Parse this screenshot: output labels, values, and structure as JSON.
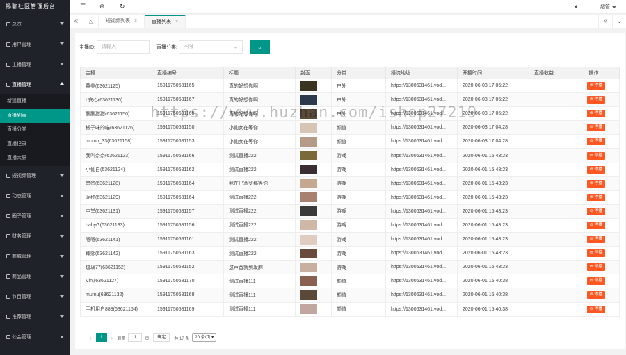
{
  "app": {
    "title": "畅聊社区管理后台"
  },
  "sidebar": {
    "items": [
      {
        "label": "总览"
      },
      {
        "label": "用户管理"
      },
      {
        "label": "主播管理"
      },
      {
        "label": "直播管理"
      },
      {
        "label": "短视频管理"
      },
      {
        "label": "动态管理"
      },
      {
        "label": "圈子管理"
      },
      {
        "label": "财务管理"
      },
      {
        "label": "商城管理"
      },
      {
        "label": "商品管理"
      },
      {
        "label": "节目管理"
      },
      {
        "label": "推荐管理"
      },
      {
        "label": "公会管理"
      }
    ],
    "sub_items": [
      {
        "label": "新建直播"
      },
      {
        "label": "直播列表"
      },
      {
        "label": "直播分类"
      },
      {
        "label": "直播记录"
      },
      {
        "label": "直播大屏"
      }
    ]
  },
  "header": {
    "user": "超管"
  },
  "tabs": [
    {
      "label": "短视频列表",
      "close": "×"
    },
    {
      "label": "直播列表",
      "close": "×"
    }
  ],
  "search": {
    "anchor_label": "主播ID:",
    "anchor_placeholder": "请输入",
    "category_label": "直播分类:",
    "category_value": "不限"
  },
  "table": {
    "columns": [
      "主播",
      "直播编号",
      "标题",
      "封面",
      "分类",
      "播流地址",
      "开播时间",
      "直播收益",
      "操作"
    ],
    "delete_label": "⊘ 停播",
    "rows": [
      {
        "anchor": "董美(63621125)",
        "no": "15911750681165",
        "title": "真的好想你啊",
        "category": "户外",
        "url": "https://1300631461.vod...",
        "time": "2020-06-03 17:06:22",
        "color": "#3a3420"
      },
      {
        "anchor": "L安心(63621130)",
        "no": "15911750681167",
        "title": "真的好想你啊",
        "category": "户外",
        "url": "https://1300631461.vod...",
        "time": "2020-06-03 17:06:22",
        "color": "#2d3a4a"
      },
      {
        "anchor": "酸酸甜甜(63621150)",
        "no": "15911750681168",
        "title": "真的好想你啊",
        "category": "户外",
        "url": "https://1300631461.vod...",
        "time": "2020-06-03 17:06:22",
        "color": "#5a4a3a"
      },
      {
        "anchor": "橘子味的喵(63621126)",
        "no": "15911750681150",
        "title": "小仙女在等你",
        "category": "颜值",
        "url": "https://1300631461.vod...",
        "time": "2020-06-03 17:04:28",
        "color": "#d8c4b4"
      },
      {
        "anchor": "momo_33(63621158)",
        "no": "15911750681153",
        "title": "小仙女在等你",
        "category": "颜值",
        "url": "https://1300631461.vod...",
        "time": "2020-06-03 17:04:28",
        "color": "#b59a88"
      },
      {
        "anchor": "我叫奈奈(63621123)",
        "no": "15911750681166",
        "title": "测试直播222",
        "category": "游戏",
        "url": "https://1300631461.vod...",
        "time": "2020-06-01 15:43:23",
        "color": "#7a6a3a"
      },
      {
        "anchor": "小仙白(63621124)",
        "no": "15911750681162",
        "title": "测试直播222",
        "category": "游戏",
        "url": "https://1300631461.vod...",
        "time": "2020-06-01 15:43:23",
        "color": "#3a2e34"
      },
      {
        "anchor": "悠然(63621128)",
        "no": "15911750681164",
        "title": "我在巴塞罗那等你",
        "category": "游戏",
        "url": "https://1300631461.vod...",
        "time": "2020-06-01 15:43:23",
        "color": "#c4a890"
      },
      {
        "anchor": "昵称(63621129)",
        "no": "15911750681164",
        "title": "测试直播222",
        "category": "游戏",
        "url": "https://1300631461.vod...",
        "time": "2020-06-01 15:43:23",
        "color": "#a88070"
      },
      {
        "anchor": "中堂(63621131)",
        "no": "15911750681157",
        "title": "测试直播222",
        "category": "游戏",
        "url": "https://1300631461.vod...",
        "time": "2020-06-01 15:43:23",
        "color": "#3a3a3a"
      },
      {
        "anchor": "babyG(63621133)",
        "no": "15911750681156",
        "title": "测试直播222",
        "category": "游戏",
        "url": "https://1300631461.vod...",
        "time": "2020-06-01 15:43:23",
        "color": "#d0b8a8"
      },
      {
        "anchor": "嗯嗯(63621141)",
        "no": "15911750681161",
        "title": "测试直播222",
        "category": "游戏",
        "url": "https://1300631461.vod...",
        "time": "2020-06-01 15:43:23",
        "color": "#e0ccc0"
      },
      {
        "anchor": "臻熙(63621142)",
        "no": "15911750681163",
        "title": "测试直播222",
        "category": "游戏",
        "url": "https://1300631461.vod...",
        "time": "2020-06-01 15:43:23",
        "color": "#6a4a3a"
      },
      {
        "anchor": "琉璃77(63621152)",
        "no": "15911750681152",
        "title": "这声音就到发麻",
        "category": "游戏",
        "url": "https://1300631461.vod...",
        "time": "2020-06-01 15:43:23",
        "color": "#c8b0a0"
      },
      {
        "anchor": "Vin,(63621127)",
        "no": "15911750681170",
        "title": "测试直播111",
        "category": "颜值",
        "url": "https://1300631461.vod...",
        "time": "2020-06-01 15:40:38",
        "color": "#8a6050"
      },
      {
        "anchor": "mumu(63621132)",
        "no": "15911750681168",
        "title": "测试直播111",
        "category": "颜值",
        "url": "https://1300631461.vod...",
        "time": "2020-06-01 15:40:38",
        "color": "#5a4838"
      },
      {
        "anchor": "手机用户888(63621154)",
        "no": "15911750681169",
        "title": "测试直播111",
        "category": "颜值",
        "url": "https://1300631461.vod...",
        "time": "2020-06-01 15:40:38",
        "color": "#c0a8a0"
      }
    ]
  },
  "pager": {
    "current": "1",
    "goto_prefix": "到第",
    "goto_value": "1",
    "goto_suffix": "页",
    "confirm": "确定",
    "total": "共 17 条",
    "page_size": "20 条/页 ▾"
  },
  "watermark": "https://www.huzhan.com/ishop27219"
}
